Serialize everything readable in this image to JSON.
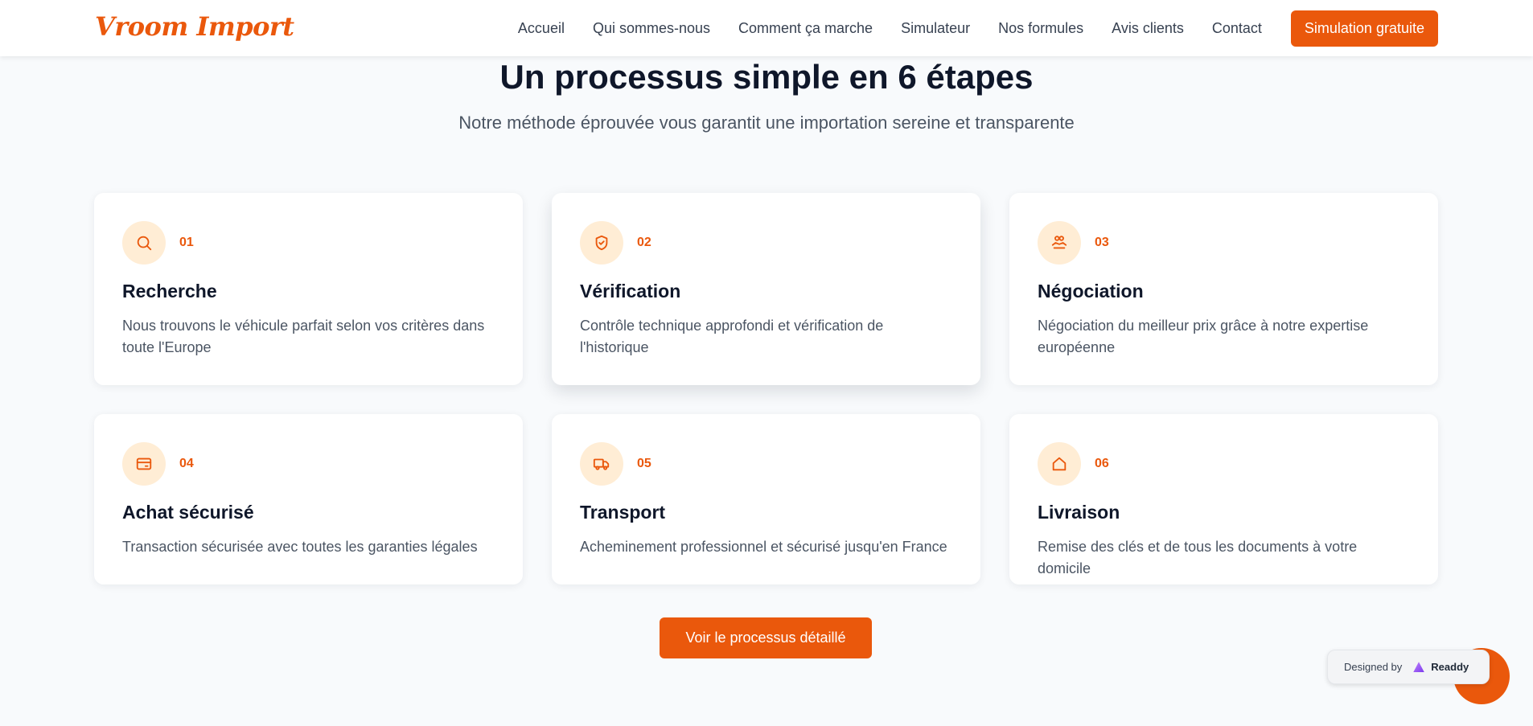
{
  "brand": {
    "logo_text": "Vroom Import",
    "accent_color": "#ea580c"
  },
  "nav": {
    "links": [
      "Accueil",
      "Qui sommes-nous",
      "Comment ça marche",
      "Simulateur",
      "Nos formules",
      "Avis clients",
      "Contact"
    ],
    "cta_label": "Simulation gratuite"
  },
  "section": {
    "title": "Un processus simple en 6 étapes",
    "subtitle": "Notre méthode éprouvée vous garantit une importation sereine et transparente"
  },
  "steps": [
    {
      "number": "01",
      "icon": "search-icon",
      "title": "Recherche",
      "description": "Nous trouvons le véhicule parfait selon vos critères dans toute l'Europe"
    },
    {
      "number": "02",
      "icon": "shield-check-icon",
      "title": "Vérification",
      "description": "Contrôle technique approfondi et vérification de l'historique"
    },
    {
      "number": "03",
      "icon": "handshake-icon",
      "title": "Négociation",
      "description": "Négociation du meilleur prix grâce à notre expertise européenne"
    },
    {
      "number": "04",
      "icon": "credit-card-icon",
      "title": "Achat sécurisé",
      "description": "Transaction sécurisée avec toutes les garanties légales"
    },
    {
      "number": "05",
      "icon": "truck-icon",
      "title": "Transport",
      "description": "Acheminement professionnel et sécurisé jusqu'en France"
    },
    {
      "number": "06",
      "icon": "home-icon",
      "title": "Livraison",
      "description": "Remise des clés et de tous les documents à votre domicile"
    }
  ],
  "cta": {
    "label": "Voir le processus détaillé"
  },
  "badge": {
    "prefix": "Designed by",
    "brand": "Readdy"
  }
}
